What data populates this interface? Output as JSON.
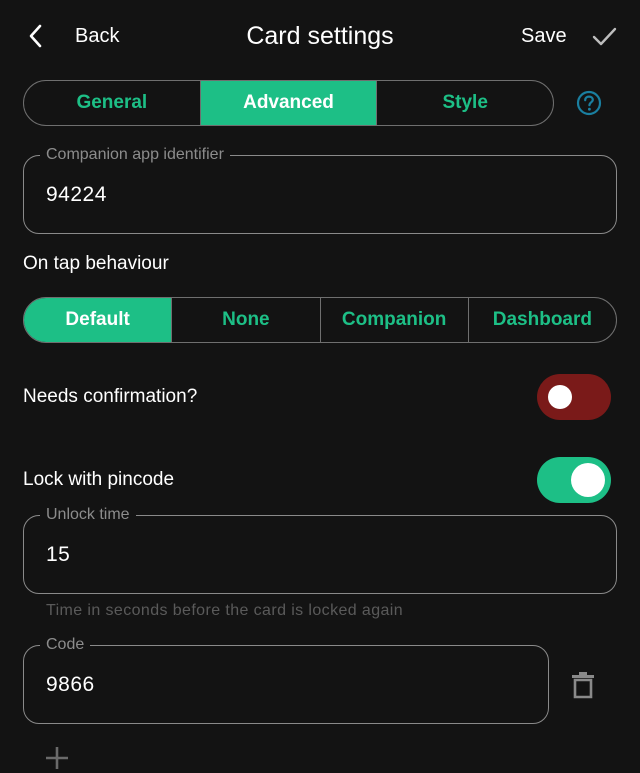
{
  "header": {
    "back_label": "Back",
    "title": "Card settings",
    "save_label": "Save",
    "icons": [
      "chevron-left-icon",
      "check-icon"
    ]
  },
  "tabs": [
    {
      "label": "General",
      "active": false
    },
    {
      "label": "Advanced",
      "active": true
    },
    {
      "label": "Style",
      "active": false
    }
  ],
  "help_icon": "help-circle-icon",
  "companion_field": {
    "label": "Companion app identifier",
    "value": "94224"
  },
  "on_tap": {
    "label": "On tap behaviour",
    "options": [
      {
        "label": "Default",
        "active": true
      },
      {
        "label": "None",
        "active": false
      },
      {
        "label": "Companion",
        "active": false
      },
      {
        "label": "Dashboard",
        "active": false
      }
    ]
  },
  "needs_confirmation": {
    "label": "Needs confirmation?",
    "checked": false
  },
  "lock_pincode": {
    "label": "Lock with pincode",
    "checked": true
  },
  "unlock_time": {
    "label": "Unlock time",
    "value": "15",
    "helper": "Time in seconds before the card is locked again"
  },
  "code": {
    "label": "Code",
    "value": "9866"
  },
  "colors": {
    "accent": "#1dbf86",
    "toggle_off": "#7a1a19",
    "background": "#131313",
    "help_icon": "#1a7fa0"
  }
}
